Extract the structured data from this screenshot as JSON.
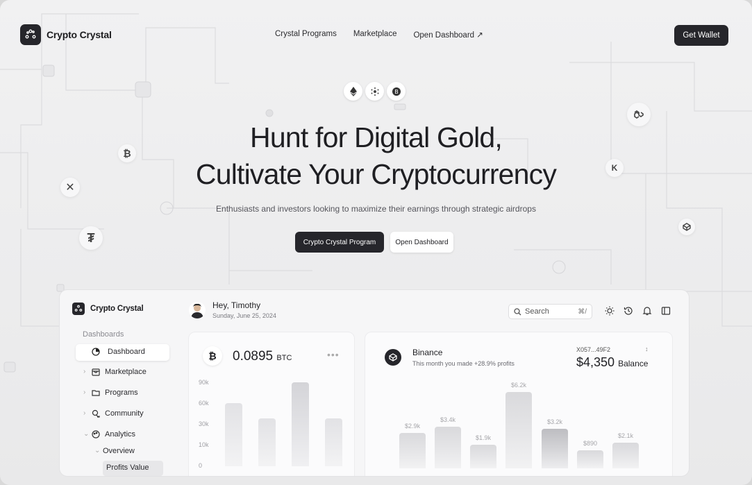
{
  "brand": {
    "name": "Crypto Crystal"
  },
  "nav": {
    "links": [
      "Crystal Programs",
      "Marketplace",
      "Open Dashboard ↗"
    ],
    "cta": "Get Wallet"
  },
  "hero": {
    "title_line1": "Hunt for Digital Gold,",
    "title_line2": "Cultivate Your Cryptocurrency",
    "subtitle": "Enthusiasts and investors looking to maximize their earnings through strategic airdrops",
    "primary_button": "Crypto Crystal Program",
    "secondary_button": "Open Dashboard"
  },
  "chips": [
    "ethereum-icon",
    "cardano-icon",
    "bancor-icon"
  ],
  "floating_icons": [
    "bitcoin-icon",
    "x-icon",
    "tether-icon",
    "polygon-icon",
    "kucoin-icon",
    "binance-coin-icon"
  ],
  "dashboard": {
    "brand": "Crypto Crystal",
    "section_label": "Dashboards",
    "sidebar": [
      {
        "label": "Dashboard",
        "icon": "pie-chart-icon",
        "active": true
      },
      {
        "label": "Marketplace",
        "icon": "store-icon"
      },
      {
        "label": "Programs",
        "icon": "folder-icon"
      },
      {
        "label": "Community",
        "icon": "chat-icon"
      },
      {
        "label": "Analytics",
        "icon": "palette-icon"
      },
      {
        "label": "Overview"
      },
      {
        "label": "Profits Value"
      }
    ],
    "greeting": {
      "name": "Hey, Timothy",
      "date": "Sunday, June 25, 2024"
    },
    "search": {
      "placeholder": "Search",
      "shortcut": "⌘/"
    },
    "btc_card": {
      "value": "0.0895",
      "unit": "BTC",
      "more": "•••",
      "y_ticks": [
        "90k",
        "60k",
        "30k",
        "10k",
        "0"
      ],
      "bar_values_k": [
        68,
        52,
        91,
        52
      ]
    },
    "binance_card": {
      "name": "Binance",
      "subtitle": "This month you made +28.9% profits",
      "account": "X057...49F2",
      "balance": "$4,350",
      "balance_label": "Balance",
      "bar_labels": [
        "$2.9k",
        "$3.4k",
        "$1.9k",
        "$6.2k",
        "$3.2k",
        "$890",
        "$2.1k"
      ],
      "bar_values": [
        2900,
        3400,
        1900,
        6200,
        3200,
        890,
        2100
      ]
    }
  },
  "colors": {
    "dark": "#26262b",
    "background": "#ececed",
    "card": "#fbfbfc"
  }
}
